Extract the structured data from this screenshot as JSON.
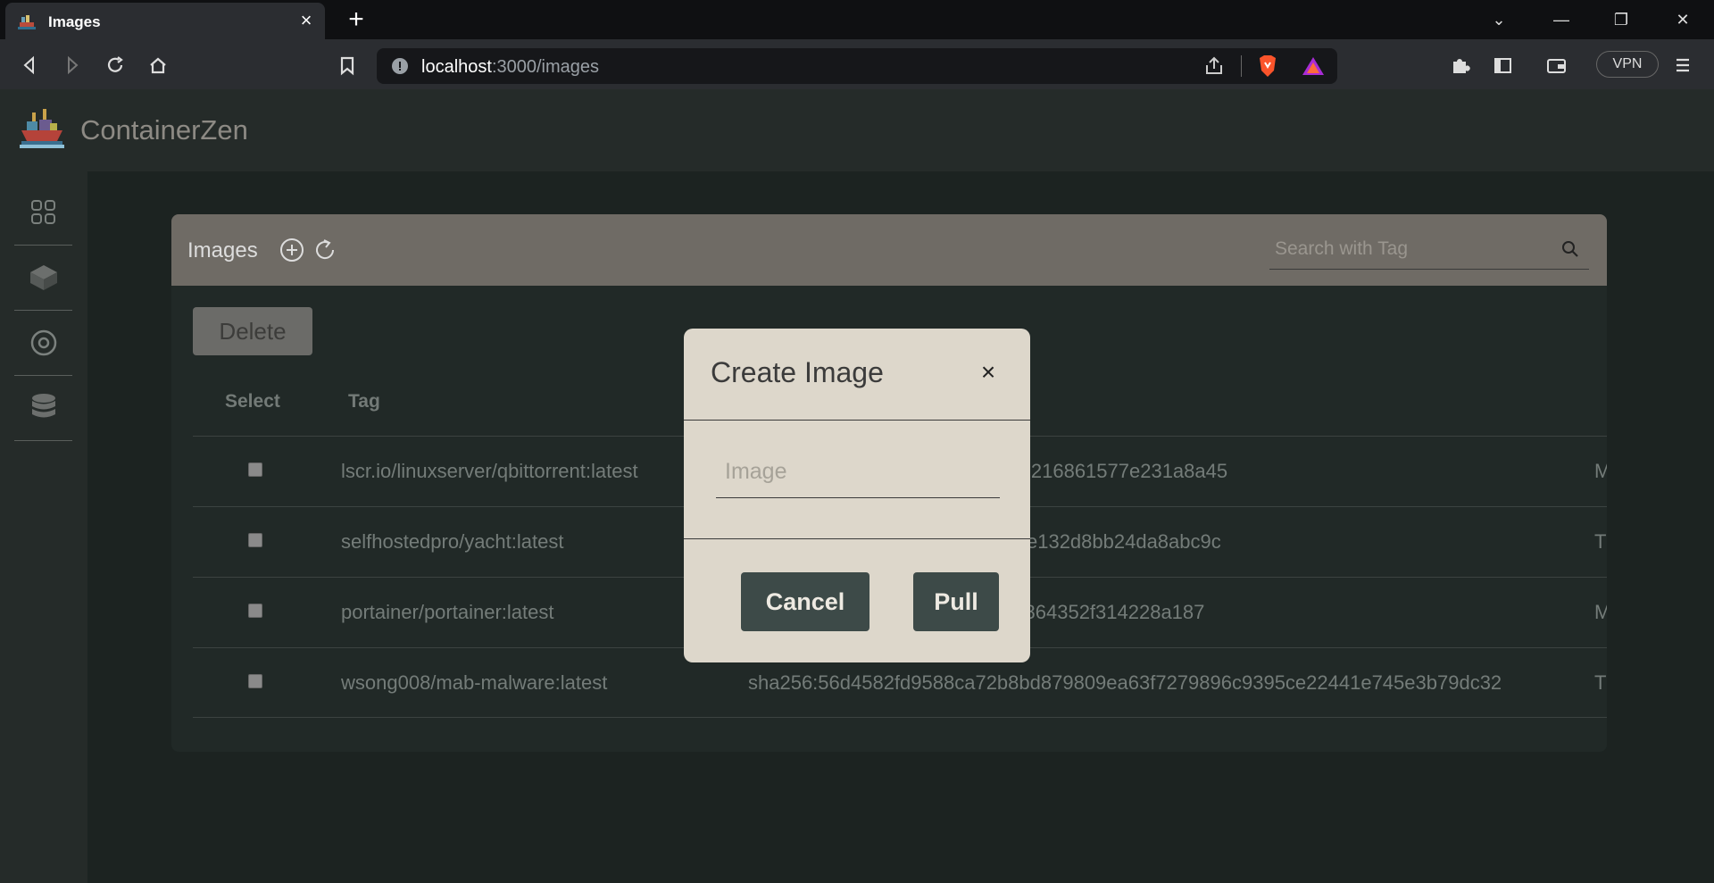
{
  "browser": {
    "tab_title": "Images",
    "url_host": "localhost",
    "url_path": ":3000/images",
    "vpn_label": "VPN"
  },
  "app": {
    "name": "ContainerZen"
  },
  "sidebar": {
    "items": [
      {
        "icon": "dashboard-grid-icon"
      },
      {
        "icon": "cube-icon"
      },
      {
        "icon": "volume-disc-icon"
      },
      {
        "icon": "database-icon"
      }
    ]
  },
  "images_panel": {
    "title": "Images",
    "search_placeholder": "Search with Tag",
    "delete_label": "Delete",
    "columns": [
      "Select",
      "Tag"
    ],
    "rows": [
      {
        "tag": "lscr.io/linuxserver/qbittorrent:latest",
        "id": "797f0f95242a140520e55cb1eb9216861577e231a8a45",
        "extra": "M"
      },
      {
        "tag": "selfhostedpro/yacht:latest",
        "id": "57b78a4406dfb5b0f83d83543f3e132d8bb24da8abc9c",
        "extra": "T"
      },
      {
        "tag": "portainer/portainer:latest",
        "id": "9322f7a650f42a0c1ed062efc71864352f314228a187",
        "extra": "M"
      },
      {
        "tag": "wsong008/mab-malware:latest",
        "id": "sha256:56d4582fd9588ca72b8bd879809ea63f7279896c9395ce22441e745e3b79dc32",
        "extra": "T"
      }
    ]
  },
  "modal": {
    "title": "Create Image",
    "close_label": "×",
    "input_placeholder": "Image",
    "input_value": "",
    "cancel_label": "Cancel",
    "pull_label": "Pull"
  }
}
